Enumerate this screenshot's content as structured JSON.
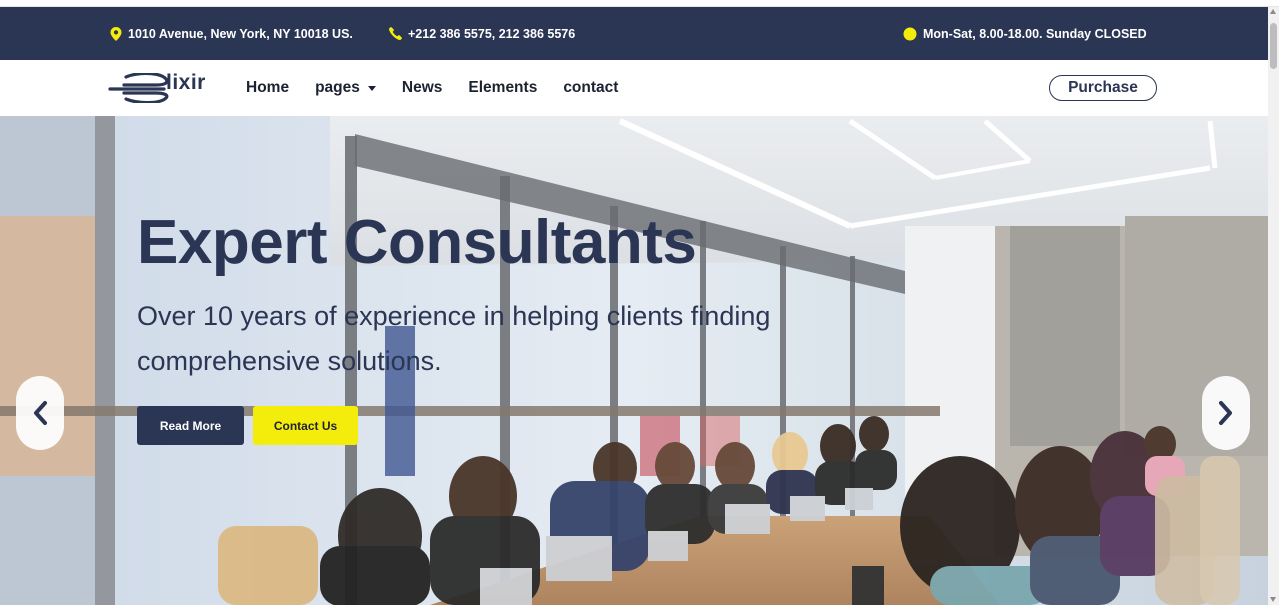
{
  "topbar": {
    "address": "1010 Avenue, New York, NY 10018 US.",
    "phone": "+212 386 5575, 212 386 5576",
    "hours": "Mon-Sat, 8.00-18.00. Sunday CLOSED",
    "icons": {
      "address": "map-pin-icon",
      "phone": "phone-icon",
      "hours": "clock-dot-icon"
    },
    "icon_color": "#f4ec0a"
  },
  "nav": {
    "logo_text": "lixir",
    "items": [
      {
        "label": "Home"
      },
      {
        "label": "pages",
        "has_dropdown": true
      },
      {
        "label": "News"
      },
      {
        "label": "Elements"
      },
      {
        "label": "contact"
      }
    ],
    "purchase_label": "Purchase"
  },
  "hero": {
    "title": "Expert Consultants",
    "subtitle": "Over 10 years of experience in helping clients finding comprehensive solutions.",
    "buttons": {
      "read_more": "Read More",
      "contact_us": "Contact Us"
    },
    "arrow_left_icon": "chevron-left-icon",
    "arrow_right_icon": "chevron-right-icon"
  },
  "colors": {
    "brand_navy": "#2b3554",
    "accent_yellow": "#f4ec0a"
  }
}
